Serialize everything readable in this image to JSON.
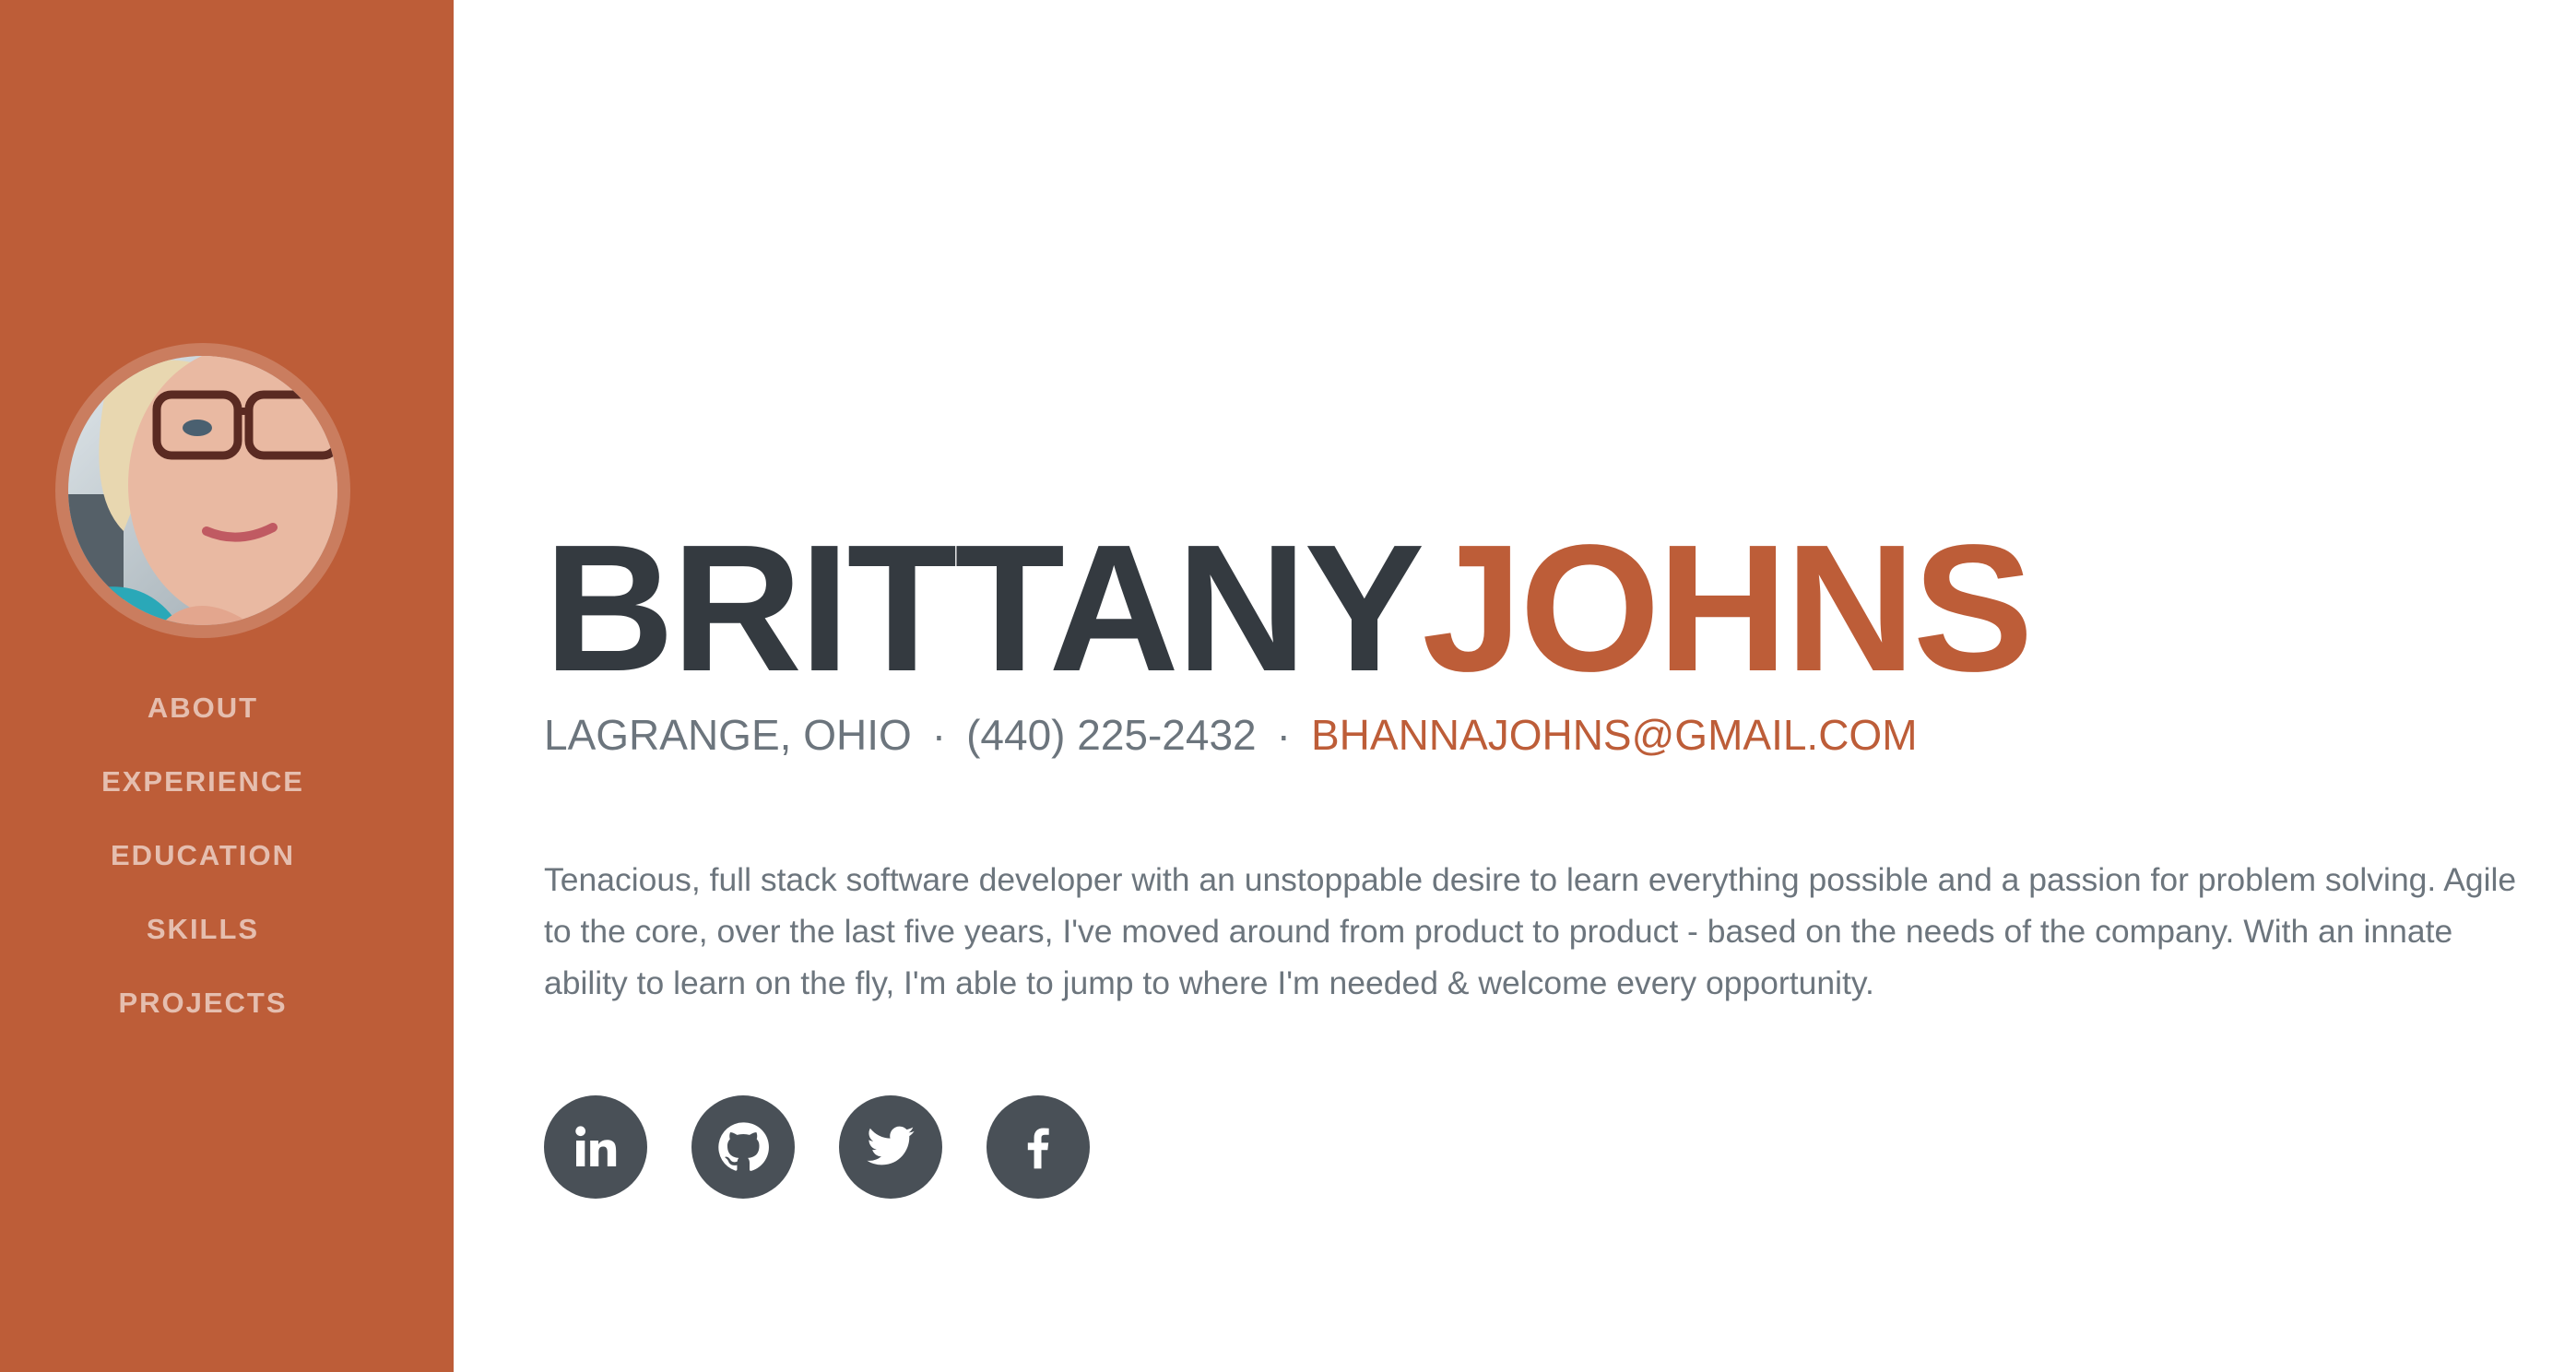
{
  "sidebar": {
    "avatar_alt": "profile photo",
    "nav": [
      {
        "label": "About"
      },
      {
        "label": "Experience"
      },
      {
        "label": "Education"
      },
      {
        "label": "Skills"
      },
      {
        "label": "Projects"
      }
    ]
  },
  "header": {
    "first_name": "BRITTANY",
    "last_name": "JOHNS"
  },
  "contact": {
    "location": "LaGrange, Ohio",
    "separator": "·",
    "phone": "(440) 225-2432",
    "email": "bhannajohns@gmail.com"
  },
  "about": {
    "text": "Tenacious, full stack software developer with an unstoppable desire to learn everything possible and a passion for problem solving. Agile to the core, over the last five years, I've moved around from product to product - based on the needs of the company. With an innate ability to learn on the fly, I'm able to jump to where I'm needed & welcome every opportunity."
  },
  "social": [
    {
      "icon": "linkedin-icon"
    },
    {
      "icon": "github-icon"
    },
    {
      "icon": "twitter-icon"
    },
    {
      "icon": "facebook-icon"
    }
  ],
  "colors": {
    "accent": "#bd5d38",
    "heading": "#343a40",
    "muted": "#6c757d",
    "social_bg": "#495057"
  }
}
